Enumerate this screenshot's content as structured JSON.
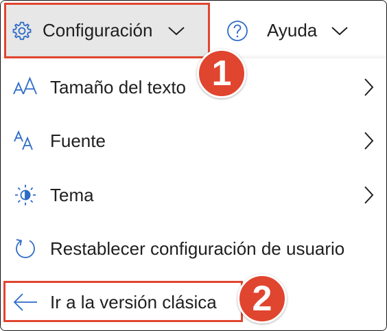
{
  "topbar": {
    "settings": {
      "label": "Configuración",
      "icon": "gear-icon"
    },
    "help": {
      "label": "Ayuda",
      "icon": "question-circle-icon"
    }
  },
  "menu": {
    "items": [
      {
        "label": "Tamaño del texto",
        "icon": "text-size-icon",
        "has_submenu": true
      },
      {
        "label": "Fuente",
        "icon": "font-icon",
        "has_submenu": true
      },
      {
        "label": "Tema",
        "icon": "brightness-icon",
        "has_submenu": true
      },
      {
        "label": "Restablecer configuración de usuario",
        "icon": "reset-icon",
        "has_submenu": false
      },
      {
        "label": "Ir a la versión clásica",
        "icon": "arrow-left-icon",
        "has_submenu": false
      }
    ]
  },
  "annotations": {
    "badge_1": "1",
    "badge_2": "2",
    "highlight_color": "#e0452f"
  },
  "colors": {
    "icon_accent": "#2d6bc7"
  }
}
